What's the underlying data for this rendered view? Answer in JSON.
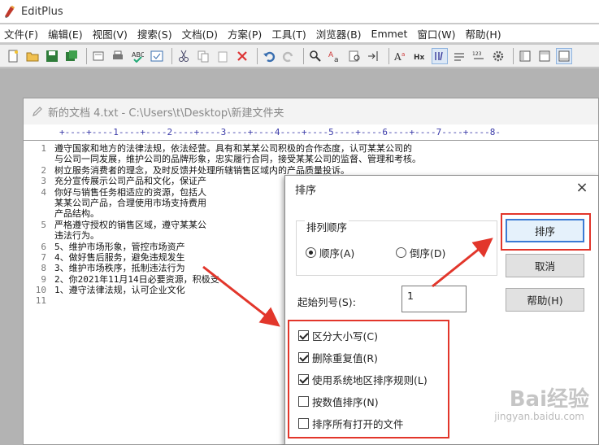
{
  "app": {
    "title": "EditPlus"
  },
  "menu": [
    "文件(F)",
    "编辑(E)",
    "视图(V)",
    "搜索(S)",
    "文档(D)",
    "方案(P)",
    "工具(T)",
    "浏览器(B)",
    "Emmet",
    "窗口(W)",
    "帮助(H)"
  ],
  "document": {
    "title": "新的文档 4.txt - C:\\Users\\t\\Desktop\\新建文件夹",
    "ruler": "+----+----1----+----2----+----3----+----4----+----5----+----6----+----7----+----8-",
    "lines": [
      {
        "n": "1",
        "t": "遵守国家和地方的法律法规，依法经营。具有和某某公司积极的合作态度，认可某某公司的"
      },
      {
        "n": "",
        "t": "与公司一同发展，维护公司的品牌形象，忠实履行合同，接受某某公司的监督、管理和考核。"
      },
      {
        "n": "2",
        "t": "树立服务消费者的理念，及时反馈并处理所辖销售区域内的产品质量投诉。"
      },
      {
        "n": "3",
        "t": "充分宣传展示公司产品和文化，保证产"
      },
      {
        "n": "4",
        "t": "你好与销售任务相适应的资源，包括人"
      },
      {
        "n": "",
        "t": "某某公司产品，合理使用市场支持费用"
      },
      {
        "n": "",
        "t": "产品结构。"
      },
      {
        "n": "5",
        "t": "严格遵守授权的销售区域，遵守某某公"
      },
      {
        "n": "",
        "t": "违法行为。"
      },
      {
        "n": "6",
        "t": "5、维护市场形象，管控市场资产"
      },
      {
        "n": "7",
        "t": "4、做好售后服务，避免违规发生"
      },
      {
        "n": "8",
        "t": "3、维护市场秩序，抵制违法行为"
      },
      {
        "n": "9",
        "t": "2、你2021年11月14日必要资源，积极支"
      },
      {
        "n": "10",
        "t": "1、遵守法律法规，认可企业文化"
      },
      {
        "n": "11",
        "t": ""
      }
    ]
  },
  "dialog": {
    "title": "排序",
    "close": "×",
    "order_group": "排列顺序",
    "asc": "顺序(A)",
    "desc": "倒序(D)",
    "start_col_label": "起始列号(S):",
    "start_col_value": "1",
    "sort_btn": "排序",
    "cancel_btn": "取消",
    "help_btn": "帮助(H)",
    "options": [
      {
        "label": "区分大小写(C)",
        "checked": true
      },
      {
        "label": "删除重复值(R)",
        "checked": true
      },
      {
        "label": "使用系统地区排序规则(L)",
        "checked": true
      },
      {
        "label": "按数值排序(N)",
        "checked": false
      },
      {
        "label": "排序所有打开的文件",
        "checked": false
      }
    ]
  },
  "colors": {
    "highlight": "#e2362b",
    "accent": "#3b7bd4"
  },
  "watermark": {
    "main": "Bai经验",
    "sub": "jingyan.baidu.com"
  }
}
